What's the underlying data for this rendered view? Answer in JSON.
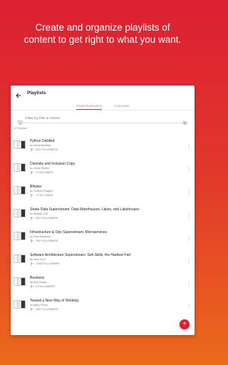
{
  "headline": {
    "line1": "Create and organize playlists of",
    "line2": "content to get right to what you want."
  },
  "appbar": {
    "title": "Playlists",
    "back_icon": "arrow-back-icon"
  },
  "tabs": [
    {
      "label": "YOUR PLAYLISTS",
      "active": true
    },
    {
      "label": "EXPLORE",
      "active": false
    }
  ],
  "filter": {
    "placeholder": "Filter by Title or Owner"
  },
  "count_label": "8 Playlists",
  "playlists": [
    {
      "title": "Python Distilled",
      "author": "by David Beazley",
      "followers": "322 FOLLOWERS"
    },
    {
      "title": "Diversity and Inclusion Copy",
      "author": "by Jesse Meeks",
      "followers": "1 FOLLOWER"
    },
    {
      "title": "BItwise",
      "author": "by Colleen Ruggeri",
      "followers": "1 FOLLOWER"
    },
    {
      "title": "Strata Data Superstream: Data Warehouses, Lakes, and Lakehouses",
      "author": "by Aliddah Coll",
      "followers": "322 FOLLOWERS"
    },
    {
      "title": "Infrastructure & Ops Superstream: Microservices",
      "author": "by Sam Newman",
      "followers": "759 FOLLOWERS"
    },
    {
      "title": "Software Architecture Superstream: Soft Skills, the Hardest Part",
      "author": "by Neal Ford",
      "followers": "1766 FOLLOWERS"
    },
    {
      "title": "Business",
      "author": "by Alex Anglin",
      "followers": "2 FOLLOWERS"
    },
    {
      "title": "Toward a New Way of Working",
      "author": "by Mary Preap",
      "followers": "336 FOLLOWERS"
    }
  ],
  "fab_label": "+",
  "colors": {
    "accent": "#d0313f",
    "background_top": "#dc1f33",
    "background_bottom": "#ec6a1c"
  }
}
